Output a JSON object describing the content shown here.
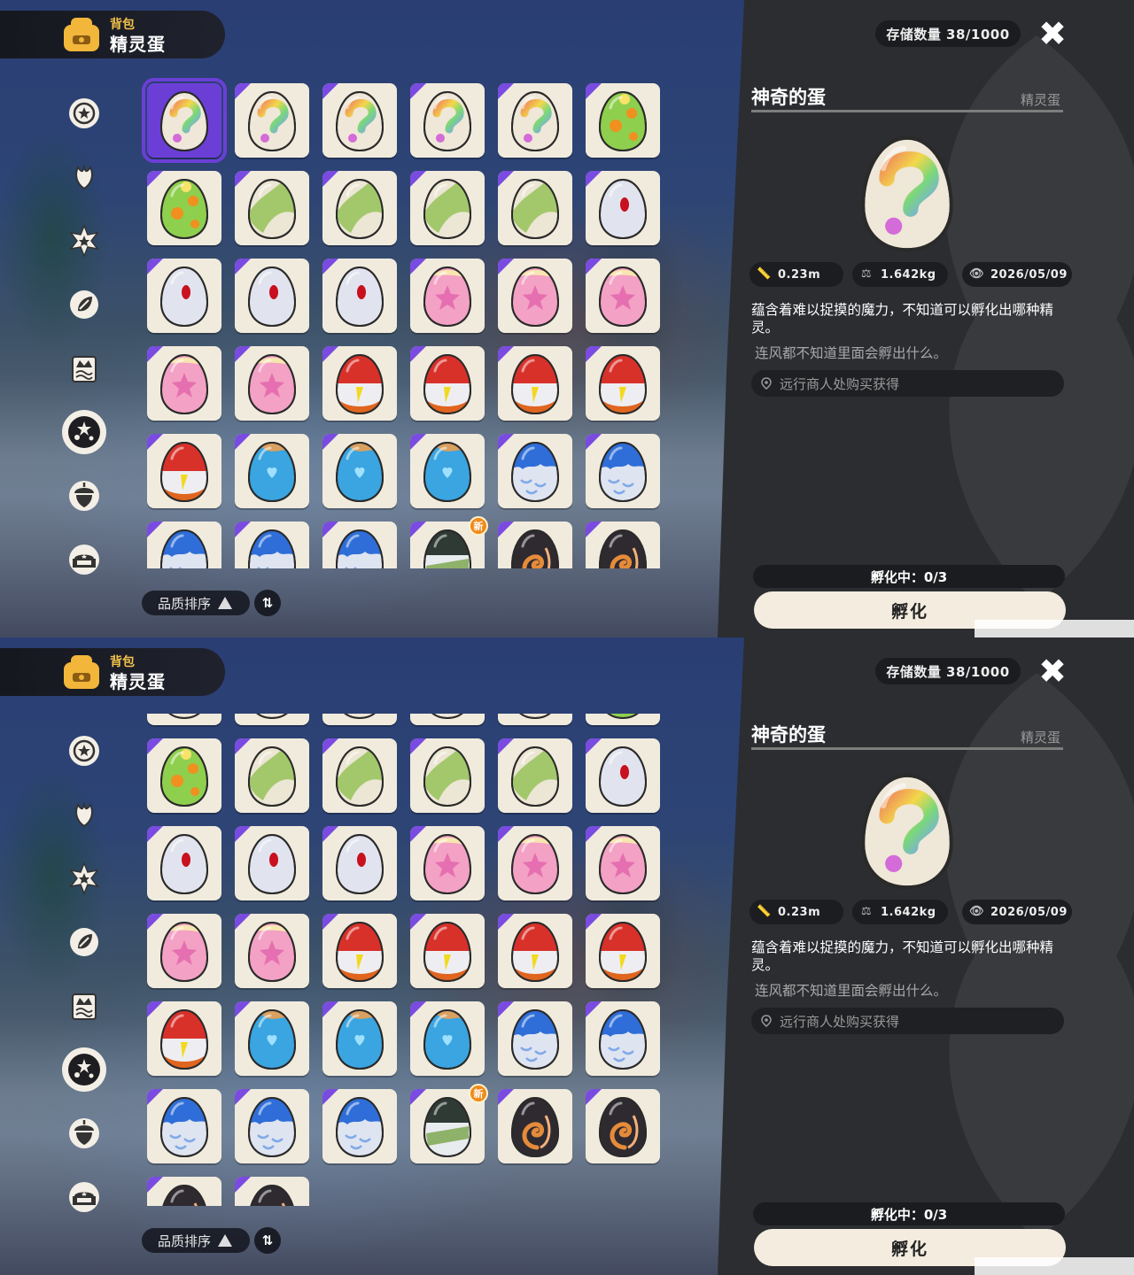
{
  "header": {
    "subtitle": "背包",
    "title": "精灵蛋"
  },
  "sidebar": [
    {
      "name": "star-badge-icon"
    },
    {
      "name": "leaf-icon"
    },
    {
      "name": "star-burst-icon"
    },
    {
      "name": "seed-icon"
    },
    {
      "name": "crown-card-icon"
    },
    {
      "name": "egg-stars-icon",
      "active": true
    },
    {
      "name": "acorn-icon"
    },
    {
      "name": "sofa-icon"
    }
  ],
  "sort": {
    "label": "品质排序"
  },
  "panel": {
    "storage": "存储数量 38/1000",
    "item_name": "神奇的蛋",
    "category": "精灵蛋",
    "height": "0.23m",
    "weight": "1.642kg",
    "date": "2026/05/09",
    "description": "蕴含着难以捉摸的魔力，不知道可以孵化出哪种精灵。",
    "flavor": "连风都不知道里面会孵出什么。",
    "source": "远行商人处购买获得",
    "hatching": "孵化中：0/3",
    "hatch_button": "孵化"
  },
  "screens": [
    {
      "scroll_row": 0,
      "selected": 0
    },
    {
      "scroll_row": 1,
      "selected": -1
    }
  ],
  "eggs": [
    "mystery",
    "mystery",
    "mystery",
    "mystery",
    "mystery",
    "green-spot",
    "green-spot",
    "green-leaf",
    "green-leaf",
    "green-leaf",
    "green-leaf",
    "white-red",
    "white-red",
    "white-red",
    "white-red",
    "pink-star",
    "pink-star",
    "pink-star",
    "pink-star",
    "pink-star",
    "red-white",
    "red-white",
    "red-white",
    "red-white",
    "red-white",
    "blue-heart",
    "blue-heart",
    "blue-heart",
    "blue-wave",
    "blue-wave",
    "blue-wave",
    "blue-wave",
    "blue-wave",
    "green-black",
    "dark-flame",
    "dark-flame",
    "dark-flame",
    "dark-flame"
  ],
  "new_badge": {
    "index": 33,
    "label": "新"
  }
}
